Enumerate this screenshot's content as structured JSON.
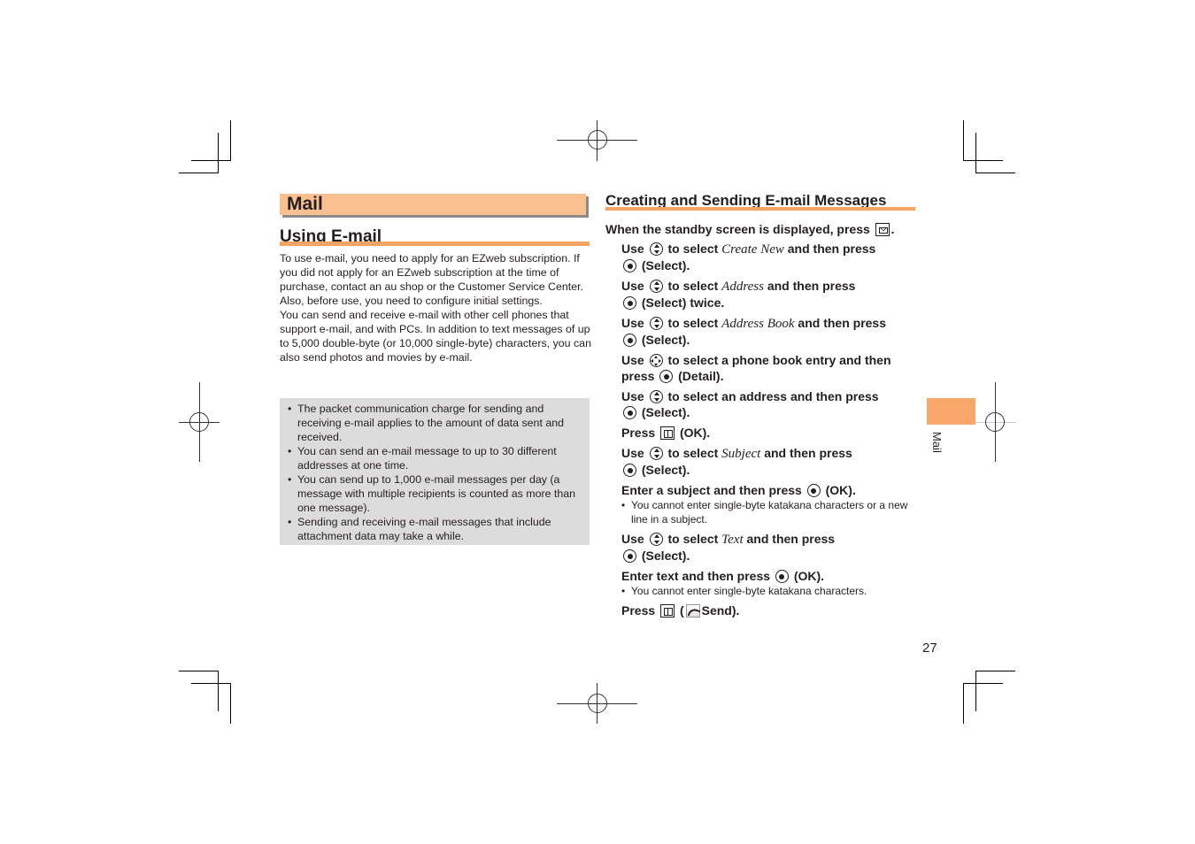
{
  "page": {
    "number": "27",
    "side_tab_label": "Mail",
    "accent_color": "#f5a462",
    "banner_color": "#fbc08f",
    "note_background": "#dcdcdc"
  },
  "left": {
    "section_title": "Mail",
    "heading": "Using E-mail",
    "paragraphs": [
      "To use e-mail, you need to apply for an EZweb subscription. If you did not apply for an EZweb subscription at the time of purchase, contact an au shop or the Customer Service Center. Also, before use, you need to configure initial settings.",
      "You can send and receive e-mail with other cell phones that support e-mail, and with PCs. In addition to text messages of up to 5,000 double-byte (or 10,000 single-byte) characters, you can also send photos and movies by e-mail."
    ],
    "notes": [
      "The packet communication charge for sending and receiving e-mail applies to the amount of data sent and received.",
      "You can send an e-mail message to up to 30 different addresses at one time.",
      "You can send up to 1,000 e-mail messages per day (a message with multiple recipients is counted as more than one message).",
      "Sending and receiving e-mail messages that include attachment data may take a while."
    ]
  },
  "right": {
    "heading": "Creating and Sending E-mail Messages",
    "intro": {
      "before": "When the standby screen is displayed, press",
      "icon": "mail-key-icon",
      "after": "."
    },
    "steps": [
      {
        "a": "Use",
        "icon1": "up-down-key-icon",
        "b": "to select",
        "item": "Create New",
        "c": "and then press",
        "icon2": "center-key-icon",
        "d": "(Select)."
      },
      {
        "a": "Use",
        "icon1": "up-down-key-icon",
        "b": "to select",
        "item": "Address",
        "c": "and then press",
        "icon2": "center-key-icon",
        "d": "(Select) twice."
      },
      {
        "a": "Use",
        "icon1": "up-down-key-icon",
        "b": "to select",
        "item": "Address Book",
        "c": "and then press",
        "icon2": "center-key-icon",
        "d": "(Select)."
      },
      {
        "a": "Use",
        "icon1": "four-way-key-icon",
        "b": "to select a phone book entry and then press",
        "icon2": "center-key-icon",
        "d": "(Detail)."
      },
      {
        "a": "Use",
        "icon1": "up-down-key-icon",
        "b": "to select an address and then press",
        "icon2": "center-key-icon",
        "d": "(Select)."
      },
      {
        "a": "Press",
        "icon1": "soft-key-icon",
        "d": "(OK)."
      },
      {
        "a": "Use",
        "icon1": "up-down-key-icon",
        "b": "to select",
        "item": "Subject",
        "c": "and then press",
        "icon2": "center-key-icon",
        "d": "(Select)."
      },
      {
        "a": "Enter a subject and then press",
        "icon1": "center-key-icon",
        "d": "(OK).",
        "note": "You cannot enter single-byte katakana characters or a new line in a subject."
      },
      {
        "a": "Use",
        "icon1": "up-down-key-icon",
        "b": "to select",
        "item": "Text",
        "c": "and then press",
        "icon2": "center-key-icon",
        "d": "(Select)."
      },
      {
        "a": "Enter text and then press",
        "icon1": "center-key-icon",
        "d": "(OK).",
        "note": "You cannot enter single-byte katakana characters."
      },
      {
        "a": "Press",
        "icon1": "soft-key-icon",
        "d_open": "(",
        "icon3": "send-icon",
        "d": "Send)."
      }
    ]
  }
}
